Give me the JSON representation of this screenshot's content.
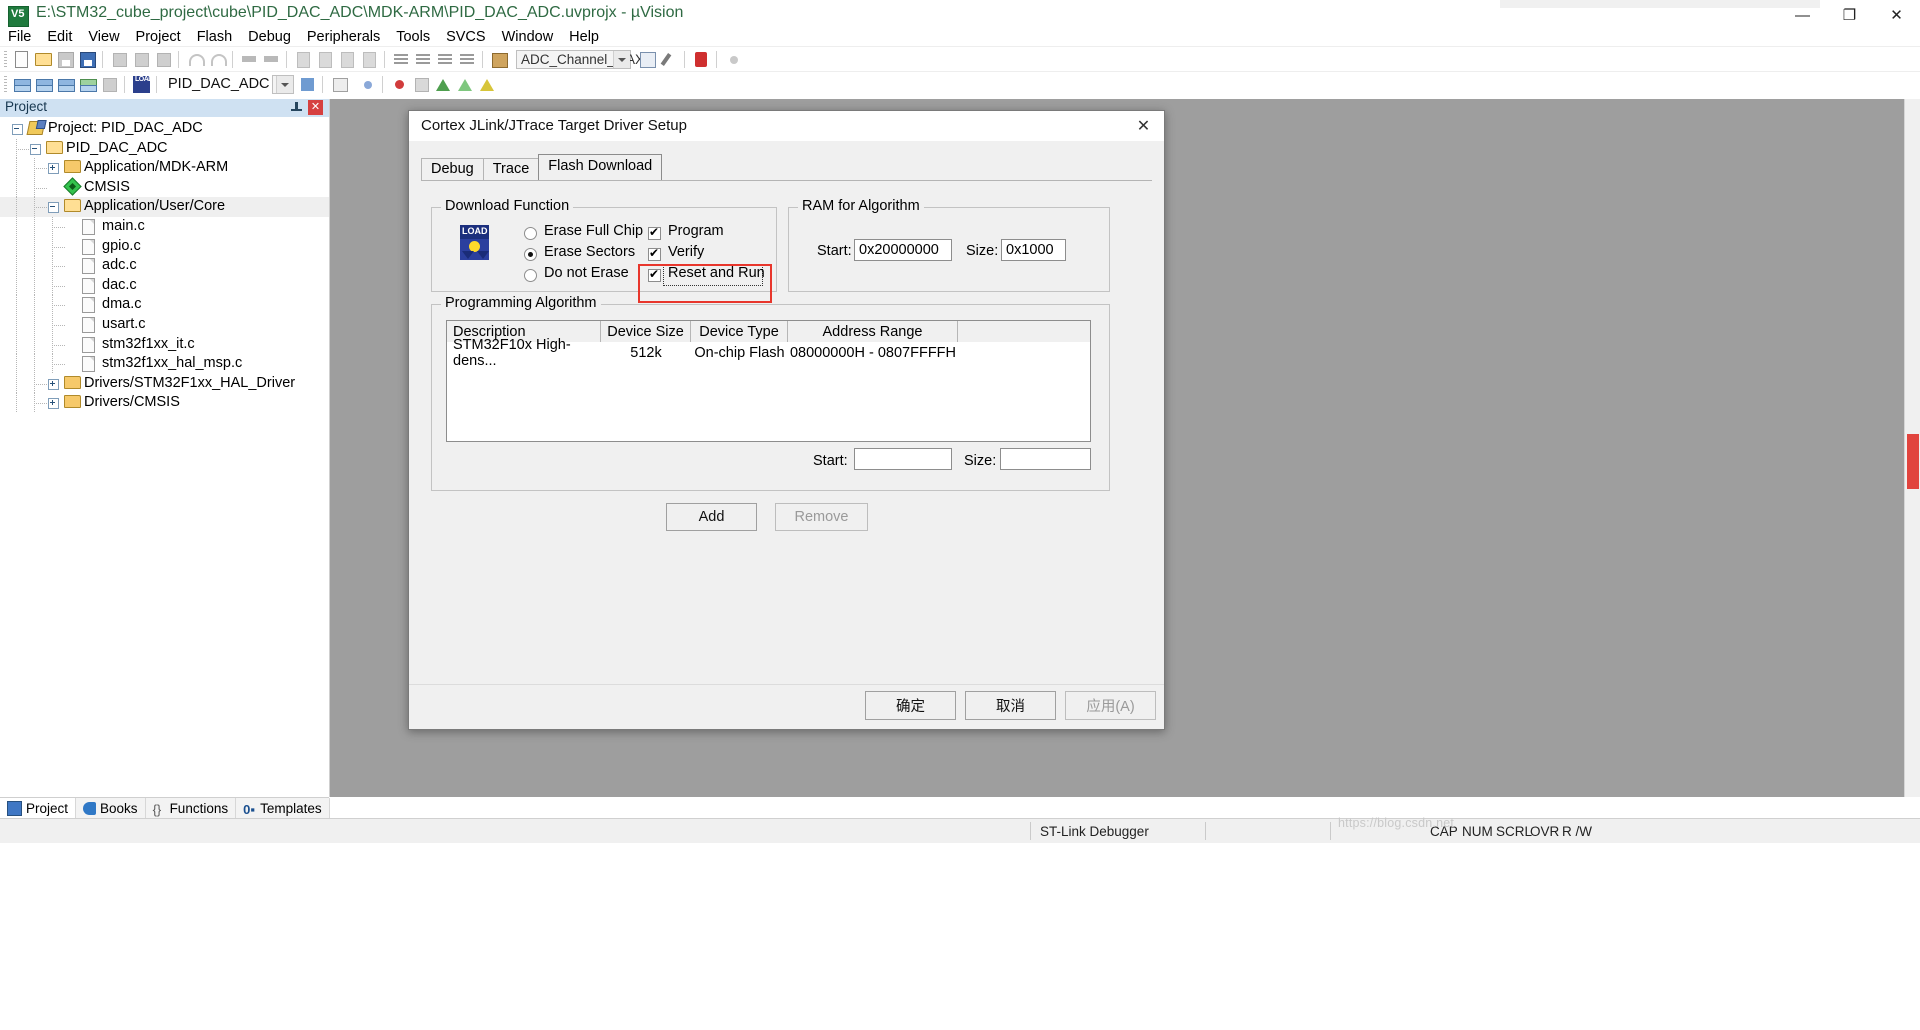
{
  "window": {
    "title": "E:\\STM32_cube_project\\cube\\PID_DAC_ADC\\MDK-ARM\\PID_DAC_ADC.uvprojx - µVision",
    "app_icon": "uvision-icon",
    "minimize": "—",
    "maximize": "❐",
    "close": "✕"
  },
  "menu": {
    "items": [
      {
        "label": "File"
      },
      {
        "label": "Edit"
      },
      {
        "label": "View"
      },
      {
        "label": "Project"
      },
      {
        "label": "Flash"
      },
      {
        "label": "Debug"
      },
      {
        "label": "Peripherals"
      },
      {
        "label": "Tools"
      },
      {
        "label": "SVCS"
      },
      {
        "label": "Window"
      },
      {
        "label": "Help"
      }
    ]
  },
  "toolbar": {
    "target_combo_value": "ADC_Channel_MAX",
    "project_combo_value": "PID_DAC_ADC"
  },
  "project_panel": {
    "title": "Project",
    "pin_icon": "pin-icon",
    "close_icon": "close-icon",
    "tree": [
      {
        "label": "Project: PID_DAC_ADC",
        "depth": 0,
        "toggle": "minus",
        "icon": "project-icon",
        "selected": false
      },
      {
        "label": "PID_DAC_ADC",
        "depth": 1,
        "toggle": "minus",
        "icon": "target-folder-icon",
        "selected": false
      },
      {
        "label": "Application/MDK-ARM",
        "depth": 2,
        "toggle": "plus",
        "icon": "folder-icon",
        "selected": false
      },
      {
        "label": "CMSIS",
        "depth": 2,
        "toggle": "none",
        "icon": "cmsis-icon",
        "selected": false
      },
      {
        "label": "Application/User/Core",
        "depth": 2,
        "toggle": "minus",
        "icon": "folder-open-icon",
        "selected": true
      },
      {
        "label": "main.c",
        "depth": 3,
        "toggle": "none",
        "icon": "c-file-icon",
        "selected": false
      },
      {
        "label": "gpio.c",
        "depth": 3,
        "toggle": "none",
        "icon": "c-file-icon",
        "selected": false
      },
      {
        "label": "adc.c",
        "depth": 3,
        "toggle": "none",
        "icon": "c-file-icon",
        "selected": false
      },
      {
        "label": "dac.c",
        "depth": 3,
        "toggle": "none",
        "icon": "c-file-icon",
        "selected": false
      },
      {
        "label": "dma.c",
        "depth": 3,
        "toggle": "none",
        "icon": "c-file-icon",
        "selected": false
      },
      {
        "label": "usart.c",
        "depth": 3,
        "toggle": "none",
        "icon": "c-file-icon",
        "selected": false
      },
      {
        "label": "stm32f1xx_it.c",
        "depth": 3,
        "toggle": "none",
        "icon": "c-file-icon",
        "selected": false
      },
      {
        "label": "stm32f1xx_hal_msp.c",
        "depth": 3,
        "toggle": "none",
        "icon": "c-file-icon",
        "selected": false
      },
      {
        "label": "Drivers/STM32F1xx_HAL_Driver",
        "depth": 2,
        "toggle": "plus",
        "icon": "folder-icon",
        "selected": false
      },
      {
        "label": "Drivers/CMSIS",
        "depth": 2,
        "toggle": "plus",
        "icon": "folder-icon",
        "selected": false
      }
    ]
  },
  "bottom_tabs": [
    {
      "label": "Project",
      "icon": "project-tab-icon",
      "active": true
    },
    {
      "label": "Books",
      "icon": "books-icon",
      "active": false
    },
    {
      "label": "Functions",
      "icon": "functions-icon",
      "active": false
    },
    {
      "label": "Templates",
      "icon": "templates-icon",
      "active": false
    }
  ],
  "dialog": {
    "title": "Cortex JLink/JTrace Target Driver Setup",
    "close_icon": "close-icon",
    "tabs": [
      {
        "label": "Debug",
        "active": false
      },
      {
        "label": "Trace",
        "active": false
      },
      {
        "label": "Flash Download",
        "active": true
      }
    ],
    "download_function": {
      "legend": "Download Function",
      "icon": "load-icon",
      "radios": [
        {
          "label": "Erase Full Chip",
          "checked": false
        },
        {
          "label": "Erase Sectors",
          "checked": true
        },
        {
          "label": "Do not Erase",
          "checked": false
        }
      ],
      "checkboxes": [
        {
          "label": "Program",
          "checked": true,
          "highlighted": false
        },
        {
          "label": "Verify",
          "checked": true,
          "highlighted": false
        },
        {
          "label": "Reset and Run",
          "checked": true,
          "highlighted": true
        }
      ]
    },
    "ram_for_algorithm": {
      "legend": "RAM for Algorithm",
      "start_label": "Start:",
      "start_value": "0x20000000",
      "size_label": "Size:",
      "size_value": "0x1000"
    },
    "programming_algorithm": {
      "legend": "Programming Algorithm",
      "columns": [
        "Description",
        "Device Size",
        "Device Type",
        "Address Range"
      ],
      "rows": [
        [
          "STM32F10x High-dens...",
          "512k",
          "On-chip Flash",
          "08000000H - 0807FFFFH"
        ]
      ],
      "start_label": "Start:",
      "start_value": "",
      "size_label": "Size:",
      "size_value": "",
      "add_label": "Add",
      "remove_label": "Remove",
      "remove_disabled": true
    },
    "footer": {
      "ok_label": "确定",
      "cancel_label": "取消",
      "apply_label": "应用(A)",
      "apply_disabled": true
    },
    "highlight_color": "#e8362c"
  },
  "statusbar": {
    "debugger": "ST-Link Debugger",
    "indicators": [
      "CAP",
      "NUM",
      "SCRL",
      "OVR",
      "R /W"
    ]
  },
  "watermark": "https://blog.csdn.net"
}
